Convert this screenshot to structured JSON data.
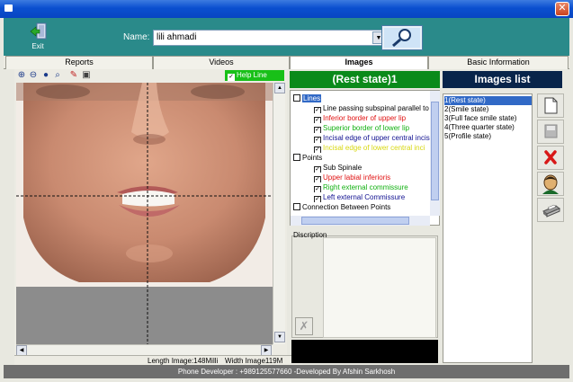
{
  "header": {
    "exit_label": "Exit",
    "name_label": "Name:",
    "name_value": "lili ahmadi"
  },
  "tabs": [
    {
      "label": "Reports"
    },
    {
      "label": "Videos"
    },
    {
      "label": "Images"
    },
    {
      "label": "Basic Information"
    }
  ],
  "toolbar": {
    "help_line_label": "Help Line",
    "help_line_checked": true
  },
  "status": {
    "length_image": "Length Image:148Milli",
    "width_image": "Width Image119M"
  },
  "middle": {
    "state_title": "(Rest state)1",
    "tree": [
      {
        "label": "Lines",
        "level": 0,
        "checked": false,
        "color": "#ffffff",
        "selected": true
      },
      {
        "label": "Line passing subspinal parallel to",
        "level": 1,
        "checked": true,
        "color": "#000000"
      },
      {
        "label": "Inferior border of upper lip",
        "level": 1,
        "checked": true,
        "color": "#e01010"
      },
      {
        "label": "Superior border of lower lip",
        "level": 1,
        "checked": true,
        "color": "#10b010"
      },
      {
        "label": "Incisal edge of upper central incis",
        "level": 1,
        "checked": true,
        "color": "#101090"
      },
      {
        "label": "Incisal edge of lower central inci",
        "level": 1,
        "checked": true,
        "color": "#d8d810"
      },
      {
        "label": "Points",
        "level": 0,
        "checked": false,
        "color": "#000000"
      },
      {
        "label": "Sub Spinale",
        "level": 1,
        "checked": true,
        "color": "#000000"
      },
      {
        "label": "Upper labial inferioris",
        "level": 1,
        "checked": true,
        "color": "#e01010"
      },
      {
        "label": "Right external commissure",
        "level": 1,
        "checked": true,
        "color": "#10b010"
      },
      {
        "label": "Left external Commissure",
        "level": 1,
        "checked": true,
        "color": "#101090"
      },
      {
        "label": "Connection Between Points",
        "level": 0,
        "checked": false,
        "color": "#000000"
      }
    ],
    "description_label": "Discription"
  },
  "right": {
    "images_list_title": "Images list",
    "items": [
      {
        "label": "1(Rest state)",
        "selected": true
      },
      {
        "label": "2(Smile state)",
        "selected": false
      },
      {
        "label": "3(Full face smile state)",
        "selected": false
      },
      {
        "label": "4(Three quarter state)",
        "selected": false
      },
      {
        "label": "5(Profile state)",
        "selected": false
      }
    ]
  },
  "footer": {
    "text": "Phone Developer : +989125577660 -Developed By Afshin Sarkhosh"
  },
  "colors": {
    "header_bg": "#2a8a8a",
    "state_header_bg": "#0a8a1a",
    "images_header_bg": "#08244a",
    "help_line_bg": "#18c018",
    "footer_bg": "#6e6e6e"
  }
}
